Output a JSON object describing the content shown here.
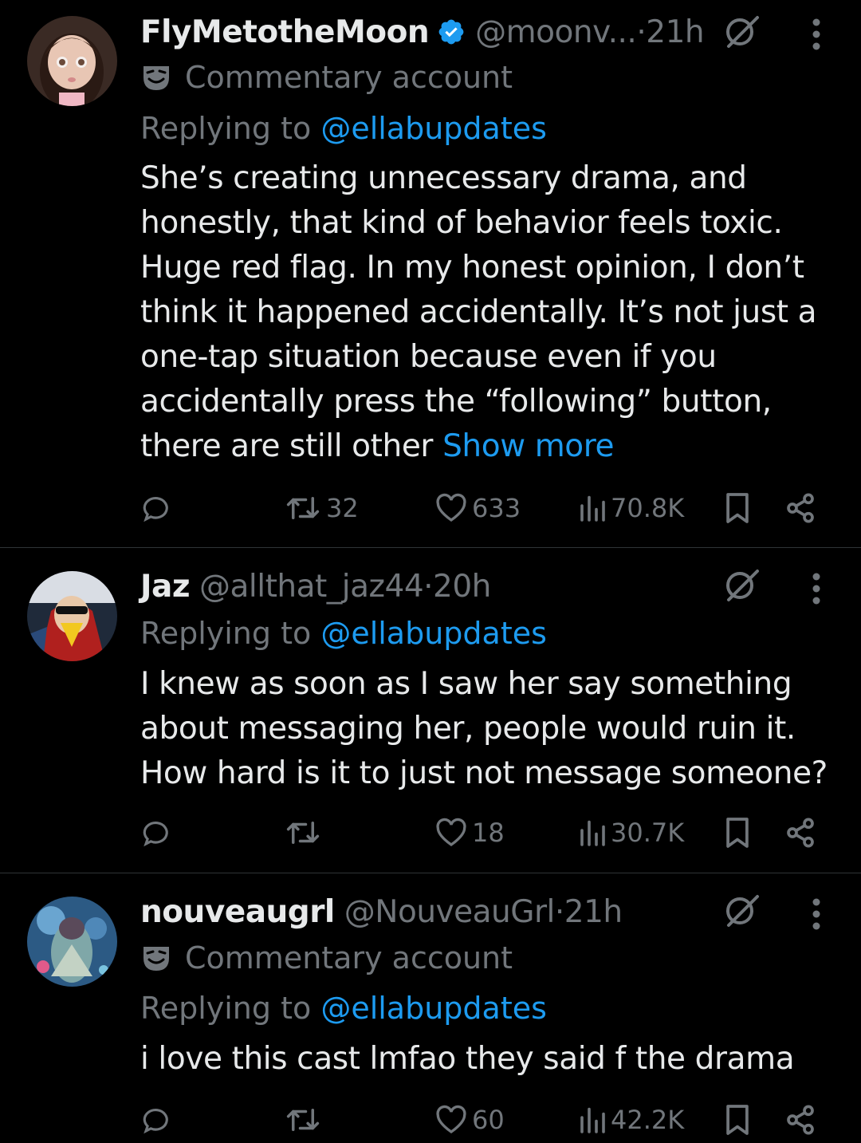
{
  "tweets": [
    {
      "name": "FlyMetotheMoon",
      "handle": "@moonv...",
      "sep": " · ",
      "time": "21h",
      "label": "Commentary account",
      "replying_prefix": "Replying to ",
      "replying_to": "@ellabupdates",
      "text": "She’s creating unnecessary drama, and honestly, that kind of behavior feels toxic. Huge red flag. In my honest opinion, I don’t think it happened accidentally. It’s not just a one-tap situation because even if you accidentally press the “following” button, there are still other ",
      "show_more": "Show more",
      "retweets": "32",
      "likes": "633",
      "views": "70.8K"
    },
    {
      "name": "Jaz",
      "handle": "@allthat_jaz44",
      "sep": " · ",
      "time": "20h",
      "replying_prefix": "Replying to ",
      "replying_to": "@ellabupdates",
      "text": "I knew as soon as I saw her say something about messaging her, people would ruin it. How hard is it to just not message someone?",
      "retweets": "",
      "likes": "18",
      "views": "30.7K"
    },
    {
      "name": "nouveaugrl",
      "handle": "@NouveauGrl",
      "sep": " · ",
      "time": "21h",
      "label": "Commentary account",
      "replying_prefix": "Replying to ",
      "replying_to": "@ellabupdates",
      "text": "i love this cast lmfao they said f the drama",
      "retweets": "",
      "likes": "60",
      "views": "42.2K"
    }
  ],
  "icons": {
    "reply": "reply-icon",
    "retweet": "retweet-icon",
    "like": "heart-icon",
    "views": "views-icon",
    "bookmark": "bookmark-icon",
    "share": "share-icon",
    "grok": "grok-icon",
    "more": "more-vertical-icon",
    "verified": "verified-badge-icon",
    "commentary": "theater-mask-icon"
  },
  "colors": {
    "background": "#000000",
    "text": "#e7e9ea",
    "muted": "#71767b",
    "link": "#1d9bf0",
    "verified": "#1d9bf0",
    "divider": "#2f3336"
  }
}
